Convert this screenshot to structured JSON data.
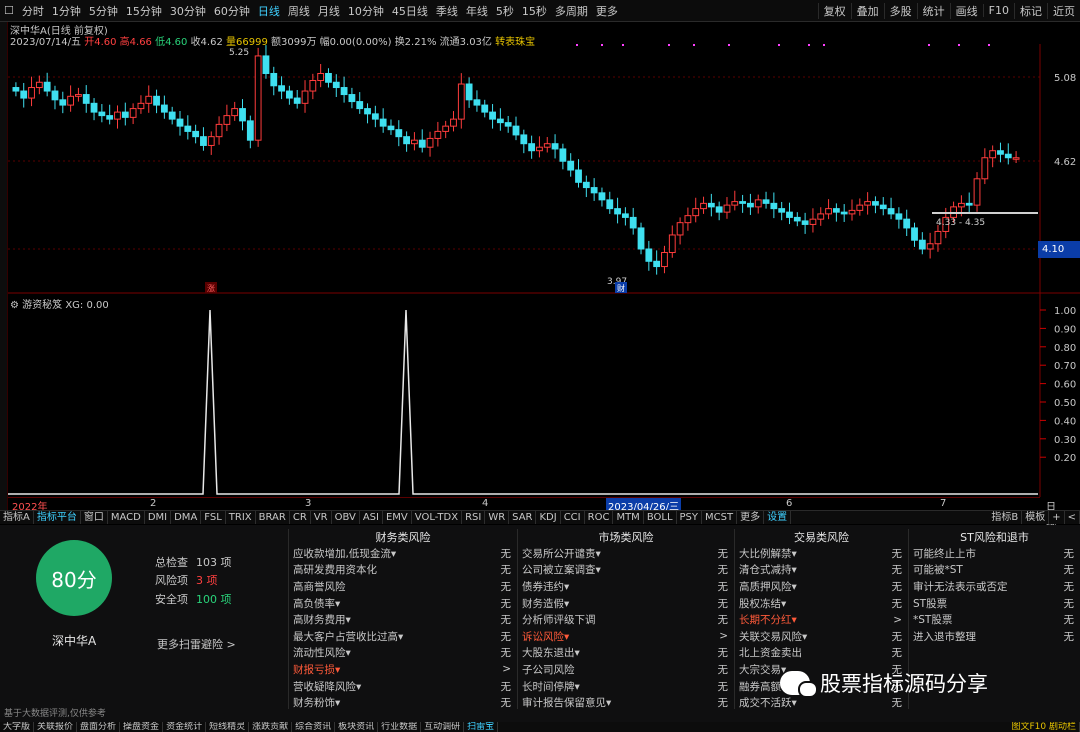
{
  "toolbar": {
    "periods": [
      "分时",
      "1分钟",
      "5分钟",
      "15分钟",
      "30分钟",
      "60分钟",
      "日线",
      "周线",
      "月线",
      "10分钟",
      "45日线",
      "季线",
      "年线",
      "5秒",
      "15秒",
      "多周期",
      "更多"
    ],
    "active_period": "日线",
    "right": [
      "复权",
      "叠加",
      "多股",
      "统计",
      "画线",
      "F10",
      "标记",
      "近页"
    ]
  },
  "quote": {
    "title": "深中华A(日线 前复权)",
    "date": "2023/07/14/五",
    "open": "开4.60",
    "high": "高4.66",
    "low": "低4.60",
    "close": "收4.62",
    "volume": "量66999",
    "amount": "额3099万",
    "change": "幅0.00(0.00%)",
    "turnover": "换2.21%",
    "float_cap": "流通3.03亿",
    "link": "转表珠宝"
  },
  "price_axis": [
    "5.08",
    "4.62",
    "4.10"
  ],
  "annotations": {
    "high_label": "5.25",
    "low_label": "3.97",
    "range_label": "4.33 - 4.35",
    "zhang": "涨",
    "cai": "财"
  },
  "chart_data": {
    "type": "candlestick",
    "indicator_title": "游资秘笈 XG: 0.00",
    "y_price_ticks": [
      5.08,
      4.62,
      4.1
    ],
    "y_indicator_ticks": [
      1.0,
      0.9,
      0.8,
      0.7,
      0.6,
      0.5,
      0.4,
      0.3,
      0.2
    ],
    "x_labels": [
      "2022年",
      "2",
      "3",
      "4",
      "2023/04/26/三",
      "6",
      "7"
    ],
    "indicator_signal_spikes": 2,
    "price_range": [
      3.97,
      5.25
    ]
  },
  "timeaxis": {
    "right_label": "日线"
  },
  "tabs": [
    "指标A",
    "指标平台",
    "窗口",
    "MACD",
    "DMI",
    "DMA",
    "FSL",
    "TRIX",
    "BRAR",
    "CR",
    "VR",
    "OBV",
    "ASI",
    "EMV",
    "VOL-TDX",
    "RSI",
    "WR",
    "SAR",
    "KDJ",
    "CCI",
    "ROC",
    "MTM",
    "BOLL",
    "PSY",
    "MCST",
    "更多",
    "设置"
  ],
  "tabs_right": [
    "指标B",
    "模板",
    "+",
    "<"
  ],
  "scan": {
    "score": "80分",
    "stock_name": "深中华A",
    "total_label": "总检查",
    "total_value": "103 项",
    "risk_label": "风险项",
    "risk_value": "3 项",
    "safe_label": "安全项",
    "safe_value": "100 项",
    "more_link": "更多扫雷避险 >",
    "basis": "基于大数据评测,仅供参考",
    "columns": [
      {
        "title": "财务类风险",
        "rows": [
          [
            "应收款增加,低现金流▾",
            "无"
          ],
          [
            "高研发费用资本化",
            "无"
          ],
          [
            "高商誉风险",
            "无"
          ],
          [
            "高负债率▾",
            "无"
          ],
          [
            "高财务费用▾",
            "无"
          ],
          [
            "最大客户占营收比过高▾",
            "无"
          ],
          [
            "流动性风险▾",
            "无"
          ],
          [
            "财报亏损▾",
            ">"
          ],
          [
            "营收疑降风险▾",
            "无"
          ],
          [
            "财务粉饰▾",
            "无"
          ]
        ]
      },
      {
        "title": "市场类风险",
        "rows": [
          [
            "交易所公开谴责▾",
            "无"
          ],
          [
            "公司被立案调查▾",
            "无"
          ],
          [
            "债券违约▾",
            "无"
          ],
          [
            "财务造假▾",
            "无"
          ],
          [
            "分析师评级下调",
            "无"
          ],
          [
            "诉讼风险▾",
            ">"
          ],
          [
            "大股东退出▾",
            "无"
          ],
          [
            "子公司风险",
            "无"
          ],
          [
            "长时间停牌▾",
            "无"
          ],
          [
            "审计报告保留意见▾",
            "无"
          ]
        ]
      },
      {
        "title": "交易类风险",
        "rows": [
          [
            "大比例解禁▾",
            "无"
          ],
          [
            "清仓式减持▾",
            "无"
          ],
          [
            "高质押风险▾",
            "无"
          ],
          [
            "股权冻结▾",
            "无"
          ],
          [
            "长期不分红▾",
            ">"
          ],
          [
            "关联交易风险▾",
            "无"
          ],
          [
            "北上资金卖出",
            "无"
          ],
          [
            "大宗交易▾",
            "无"
          ],
          [
            "融券高额▾",
            "无"
          ],
          [
            "成交不活跃▾",
            "无"
          ]
        ]
      },
      {
        "title": "ST风险和退市",
        "rows": [
          [
            "可能终止上市",
            "无"
          ],
          [
            "可能被*ST",
            "无"
          ],
          [
            "审计无法表示或否定",
            "无"
          ],
          [
            "ST股票",
            "无"
          ],
          [
            "*ST股票",
            "无"
          ],
          [
            "进入退市整理",
            "无"
          ]
        ]
      }
    ]
  },
  "watermark": "股票指标源码分享",
  "bottom_tabs": [
    "大字版",
    "关联报价",
    "盘面分析",
    "操盘资金",
    "资金统计",
    "短线精灵",
    "涨跌贡献",
    "综合资讯",
    "板块资讯",
    "行业数据",
    "互动调研",
    "扫雷宝"
  ],
  "bottom_right": "图文F10 剧动栏"
}
